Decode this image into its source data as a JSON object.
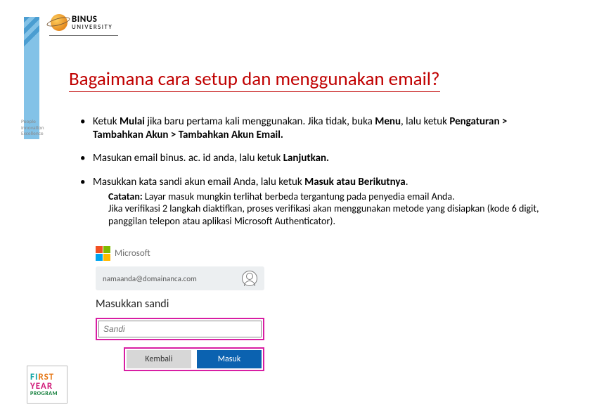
{
  "brand": {
    "name": "BINUS",
    "sub": "UNIVERSITY",
    "side_caption": "People Innovation Excellence"
  },
  "title": "Bagaimana cara setup dan menggunakan email?",
  "bullets": {
    "b1": {
      "pre": "Ketuk ",
      "mulai": "Mulai",
      "mid1": " jika baru pertama kali menggunakan. Jika tidak, buka ",
      "menu": "Menu",
      "mid2": ", lalu ketuk ",
      "path": "Pengaturan > Tambahkan Akun > Tambahkan Akun Email."
    },
    "b2": {
      "pre": "Masukan email binus. ac. id anda, lalu ketuk ",
      "lanjut": "Lanjutkan."
    },
    "b3": {
      "pre": "Masukkan kata sandi akun email Anda, lalu ketuk ",
      "masuk": "Masuk atau Berikutnya"
    }
  },
  "note": {
    "label": "Catatan:",
    "line1": " Layar masuk mungkin terlihat berbeda tergantung pada penyedia email Anda.",
    "line2": "Jika verifikasi 2 langkah diaktifkan, proses verifikasi akan menggunakan metode yang disiapkan (kode 6 digit, panggilan telepon atau aplikasi Microsoft Authenticator)."
  },
  "ms_shot": {
    "brand": "Microsoft",
    "account": "namaanda@domainanca.com",
    "prompt": "Masukkan sandi",
    "pwd_placeholder": "Sandi",
    "back_btn": "Kembali",
    "go_btn": "Masuk"
  },
  "badge": {
    "r1": "FIRST",
    "r2": "YEAR",
    "r3": "PROGRAM"
  }
}
